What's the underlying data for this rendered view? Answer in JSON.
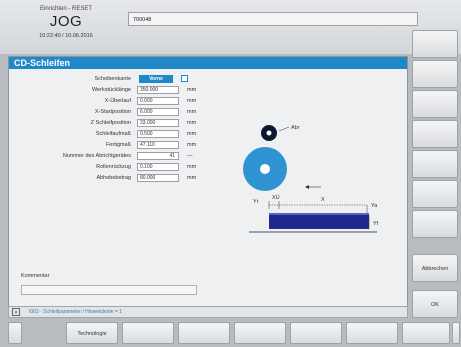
{
  "header": {
    "mode_sub": "Einrichten - RESET",
    "mode_main": "JOG",
    "datetime": "10:22:40 / 10.06.2016",
    "program_field": "700048"
  },
  "panel": {
    "title": "CD-Schleifen",
    "fields": [
      {
        "label": "Scheibenkante",
        "type": "button",
        "value": "Vorne"
      },
      {
        "label": "Werkstücklänge",
        "value": "350.000",
        "unit": "mm"
      },
      {
        "label": "X-Überlauf",
        "value": "0.000",
        "unit": "mm"
      },
      {
        "label": "X-Startposition",
        "value": "6.000",
        "unit": "mm"
      },
      {
        "label": "Z Schleifposition",
        "value": "33.000",
        "unit": "mm"
      },
      {
        "label": "Schleifaufmaß",
        "value": "0.500",
        "unit": "mm"
      },
      {
        "label": "Fertigmaß",
        "value": "47.110",
        "unit": "mm"
      },
      {
        "label": "Nummer des Abrichtgerätes",
        "value": "41",
        "unit": "—"
      },
      {
        "label": "Rollenrückzug",
        "value": "0.100",
        "unit": "mm"
      },
      {
        "label": "Abhebebetrag",
        "value": "80.000",
        "unit": "mm"
      }
    ],
    "diagram": {
      "abr_label": "Abr",
      "xu_label": "XÜ",
      "x_label": "X",
      "yr_label": "Yr",
      "ya_label": "Ya",
      "yf_label": "Yf"
    },
    "comment_label": "Kommentar",
    "comment_value": ""
  },
  "status_bar": {
    "text": "I003 · Schleifparameter / Hinweistexte = 1"
  },
  "softkeys_right": [
    "",
    "",
    "",
    "",
    "",
    "",
    "",
    "Abbrechen",
    "OK"
  ],
  "softkeys_bottom": [
    "",
    "Technologie",
    "",
    "",
    "",
    "",
    "",
    "",
    ""
  ]
}
